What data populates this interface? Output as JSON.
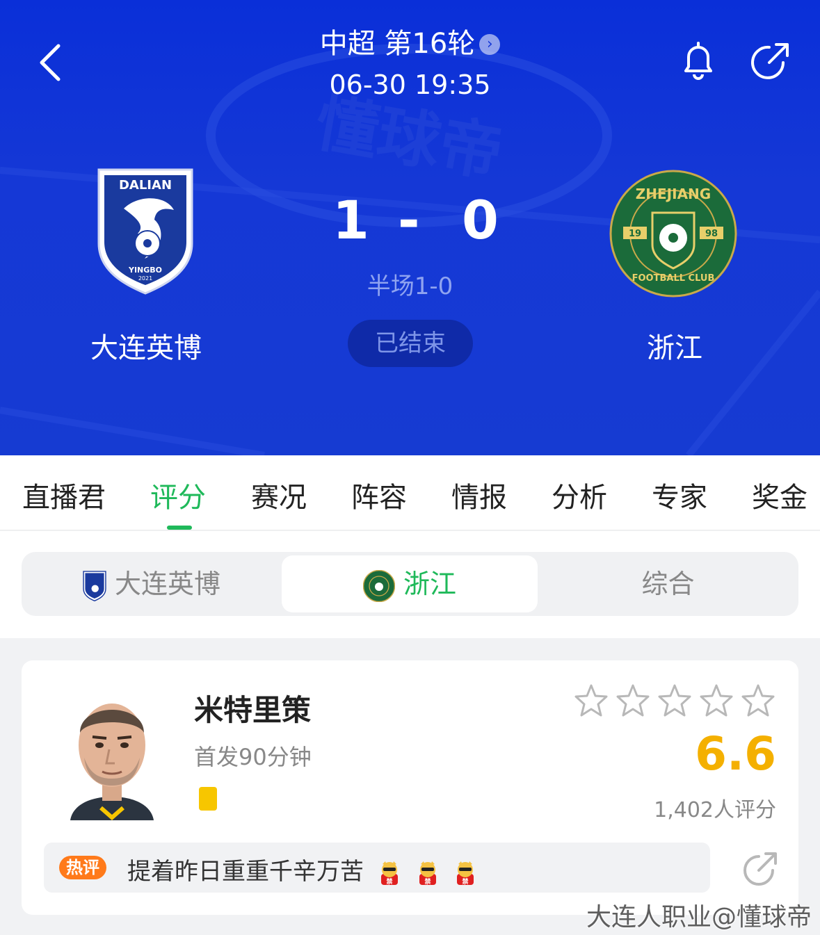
{
  "header": {
    "league_round": "中超 第16轮",
    "match_time": "06-30 19:35",
    "home": {
      "name": "大连英博",
      "score": "1",
      "logo_top": "DALIAN",
      "logo_bottom": "YINGBO",
      "logo_year": "2021"
    },
    "away": {
      "name": "浙江",
      "score": "0",
      "logo_top": "ZHEJIANG",
      "logo_bottom": "FOOTBALL CLUB",
      "logo_left": "19",
      "logo_right": "98"
    },
    "score_separator": "-",
    "halftime": "半场1-0",
    "status": "已结束",
    "colors": {
      "header_blue": "#163bd2",
      "pitch_line": "#2a4ee0"
    }
  },
  "tabs": [
    {
      "label": "直播君",
      "active": false
    },
    {
      "label": "评分",
      "active": true
    },
    {
      "label": "赛况",
      "active": false
    },
    {
      "label": "阵容",
      "active": false
    },
    {
      "label": "情报",
      "active": false
    },
    {
      "label": "分析",
      "active": false
    },
    {
      "label": "专家",
      "active": false
    },
    {
      "label": "奖金",
      "active": false
    }
  ],
  "segment": {
    "items": [
      {
        "label": "大连英博",
        "icon": "dalian-logo-icon",
        "active": false
      },
      {
        "label": "浙江",
        "icon": "zhejiang-logo-icon",
        "active": true
      },
      {
        "label": "综合",
        "active": false
      }
    ]
  },
  "player": {
    "name": "米特里策",
    "sub": "首发90分钟",
    "yellow_cards": 1,
    "stars_filled": 0,
    "stars_total": 5,
    "rating": "6.6",
    "rating_count": "1,402人评分",
    "comment_badge": "热评",
    "comment_text": "提着昨日重重千辛万苦",
    "comment_emoji": "tiger-emoji",
    "comment_emoji_count": 3
  },
  "watermark": "大连人职业@懂球帝",
  "colors": {
    "accent_green": "#1fb95a",
    "rating_gold": "#f4b000",
    "hot_orange": "#ff7a1a",
    "yellow_card": "#f7c600"
  }
}
